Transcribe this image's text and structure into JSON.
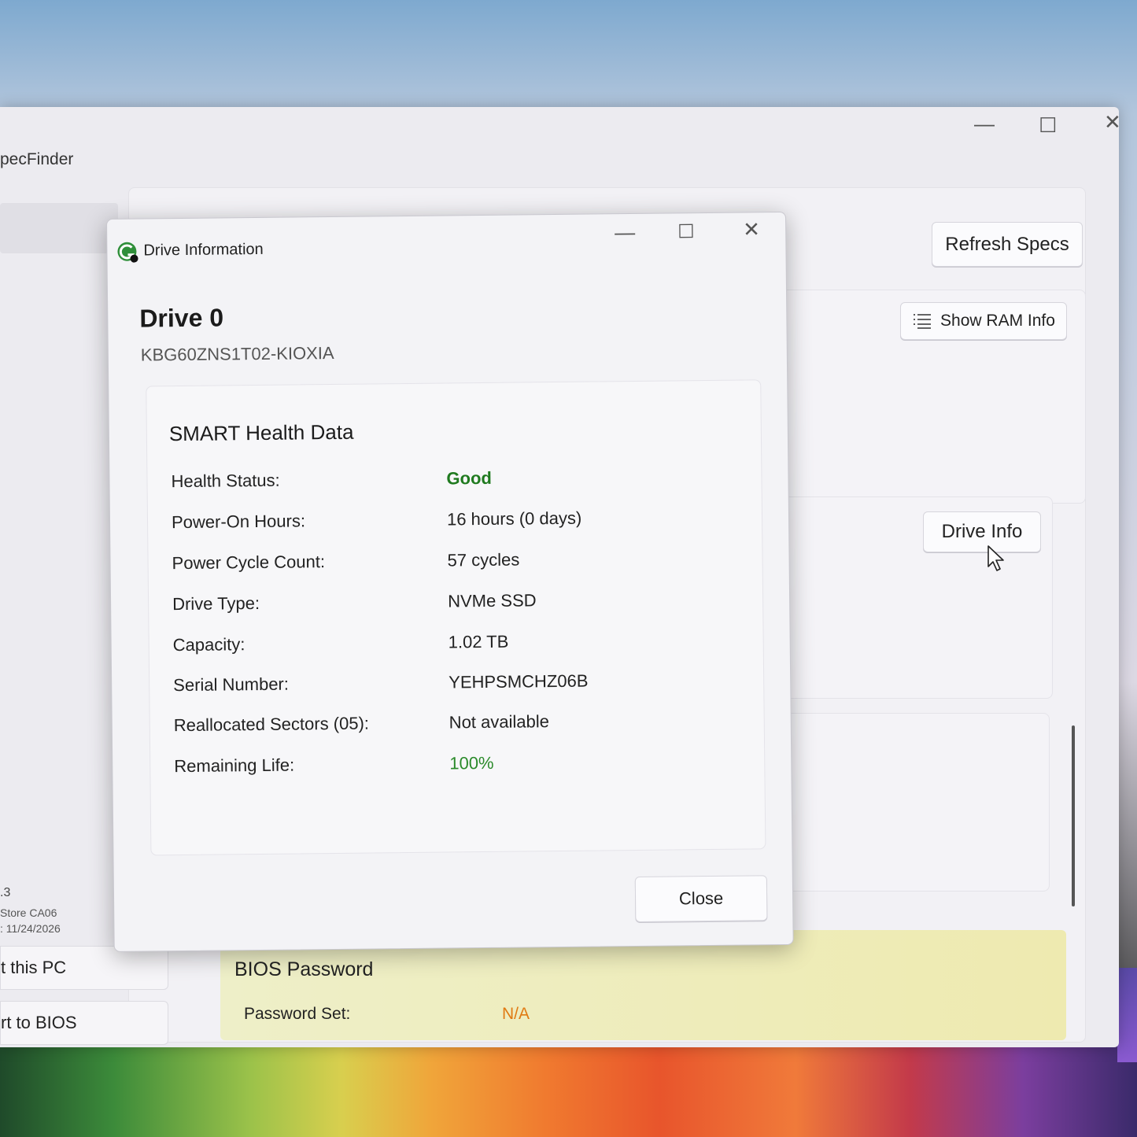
{
  "main_window": {
    "title": "pecFinder",
    "refresh_label": "Refresh Specs",
    "show_ram_label": "Show RAM Info",
    "drive_info_label": "Drive Info",
    "version_line": ".3",
    "store_line": "Store CA06",
    "date_line": ": 11/24/2026",
    "about_label": "t this PC",
    "bios_restart_label": "rt to BIOS",
    "bios_section": {
      "title": "BIOS Password",
      "password_label": "Password Set:",
      "password_value": "N/A"
    }
  },
  "dialog": {
    "title": "Drive Information",
    "drive_name": "Drive 0",
    "drive_model": "KBG60ZNS1T02-KIOXIA",
    "smart_title": "SMART Health Data",
    "rows": [
      {
        "label": "Health Status:",
        "value": "Good"
      },
      {
        "label": "Power-On Hours:",
        "value": "16 hours (0 days)"
      },
      {
        "label": "Power Cycle Count:",
        "value": "57 cycles"
      },
      {
        "label": "Drive Type:",
        "value": "NVMe SSD"
      },
      {
        "label": "Capacity:",
        "value": "1.02 TB"
      },
      {
        "label": "Serial Number:",
        "value": "YEHPSMCHZ06B"
      },
      {
        "label": "Reallocated Sectors (05):",
        "value": "Not available"
      },
      {
        "label": "Remaining Life:",
        "value": "100%"
      }
    ],
    "close_label": "Close"
  },
  "colors": {
    "health_good": "#1f7a1f",
    "remaining_life": "#2a8a2a",
    "bios_value": "#e07a12"
  },
  "icons": [
    "app-icon",
    "list-icon",
    "minimize-icon",
    "maximize-icon",
    "close-icon",
    "mouse-cursor-icon"
  ]
}
